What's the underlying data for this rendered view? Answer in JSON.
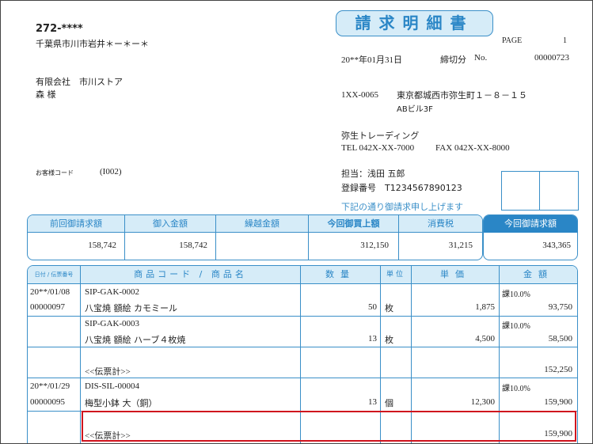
{
  "document": {
    "title": "請求明細書",
    "page_label": "PAGE",
    "page_number": "1",
    "date": "20**年01月31日",
    "closing_label": "締切分",
    "no_label": "No.",
    "number": "00000723"
  },
  "customer": {
    "postal": "272-****",
    "address": "千葉県市川市岩井＊ー＊ー＊",
    "company": "有限会社　市川ストア",
    "person": "森 様",
    "code_label": "お客様コード",
    "code": "(I002)"
  },
  "sender": {
    "postal": "1XX-0065",
    "address": "東京都城西市弥生町１－８－１５",
    "building": "ABビル3F",
    "company": "弥生トレーディング",
    "tel": "TEL 042X-XX-7000",
    "fax": "FAX 042X-XX-8000",
    "staff": "担当：浅田 五郎",
    "reg_number": "登録番号　T1234567890123",
    "note": "下記の通り御請求申し上げます"
  },
  "summary": {
    "headers": [
      "前回御請求額",
      "御入金額",
      "繰越金額",
      "今回御買上額",
      "消費税"
    ],
    "values": [
      "158,742",
      "158,742",
      "",
      "312,150",
      "31,215"
    ],
    "total_header": "今回御請求額",
    "total_value": "343,365"
  },
  "details": {
    "headers": {
      "date_slip": "日付 / 伝票番号",
      "item": "商品コード / 商品名",
      "qty": "数量",
      "unit": "単位",
      "price": "単価",
      "amount": "金額"
    },
    "rows": [
      {
        "date": "20**/01/08",
        "slip": "00000097",
        "code": "SIP-GAK-0002",
        "name": "八宝焼 額絵 カモミール",
        "qty": "50",
        "unit": "枚",
        "price": "1,875",
        "tax": "課10.0%",
        "amount": "93,750"
      },
      {
        "date": "",
        "slip": "",
        "code": "SIP-GAK-0003",
        "name": "八宝焼 額絵 ハーブ４枚焼",
        "qty": "13",
        "unit": "枚",
        "price": "4,500",
        "tax": "課10.0%",
        "amount": "58,500"
      },
      {
        "date": "",
        "slip": "",
        "code": "",
        "name": "<<伝票計>>",
        "qty": "",
        "unit": "",
        "price": "",
        "tax": "",
        "amount": "152,250"
      },
      {
        "date": "20**/01/29",
        "slip": "00000095",
        "code": "DIS-SIL-00004",
        "name": "梅型小鉢 大（銅）",
        "qty": "13",
        "unit": "個",
        "price": "12,300",
        "tax": "課10.0%",
        "amount": "159,900"
      },
      {
        "date": "",
        "slip": "",
        "code": "",
        "name": "<<伝票計>>",
        "qty": "",
        "unit": "",
        "price": "",
        "tax": "",
        "amount": "159,900"
      }
    ]
  }
}
